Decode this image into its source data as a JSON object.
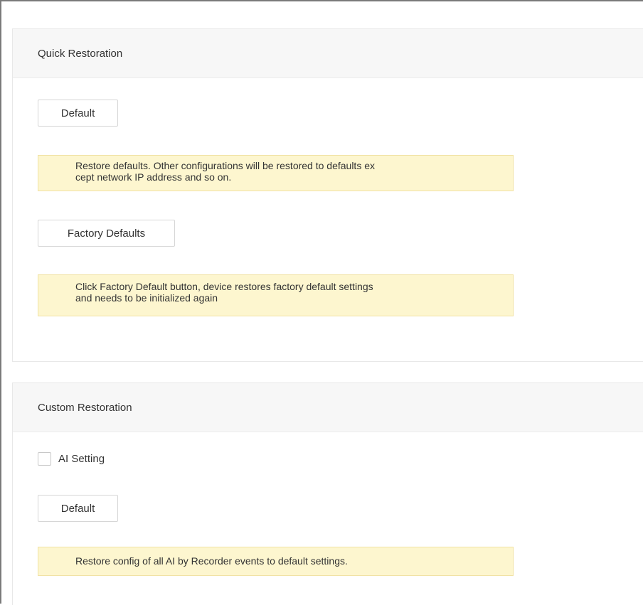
{
  "quick_restoration": {
    "title": "Quick Restoration",
    "default_button": "Default",
    "default_note": "Restore defaults. Other configurations will be restored to defaults ex\ncept network IP address and so on.",
    "factory_button": "Factory Defaults",
    "factory_note": "Click Factory Default button, device restores factory default settings\nand needs to be initialized again"
  },
  "custom_restoration": {
    "title": "Custom Restoration",
    "ai_setting": {
      "label": "AI Setting",
      "checked": false
    },
    "default_button": "Default",
    "default_note": "Restore config of all AI by Recorder events to default settings."
  }
}
